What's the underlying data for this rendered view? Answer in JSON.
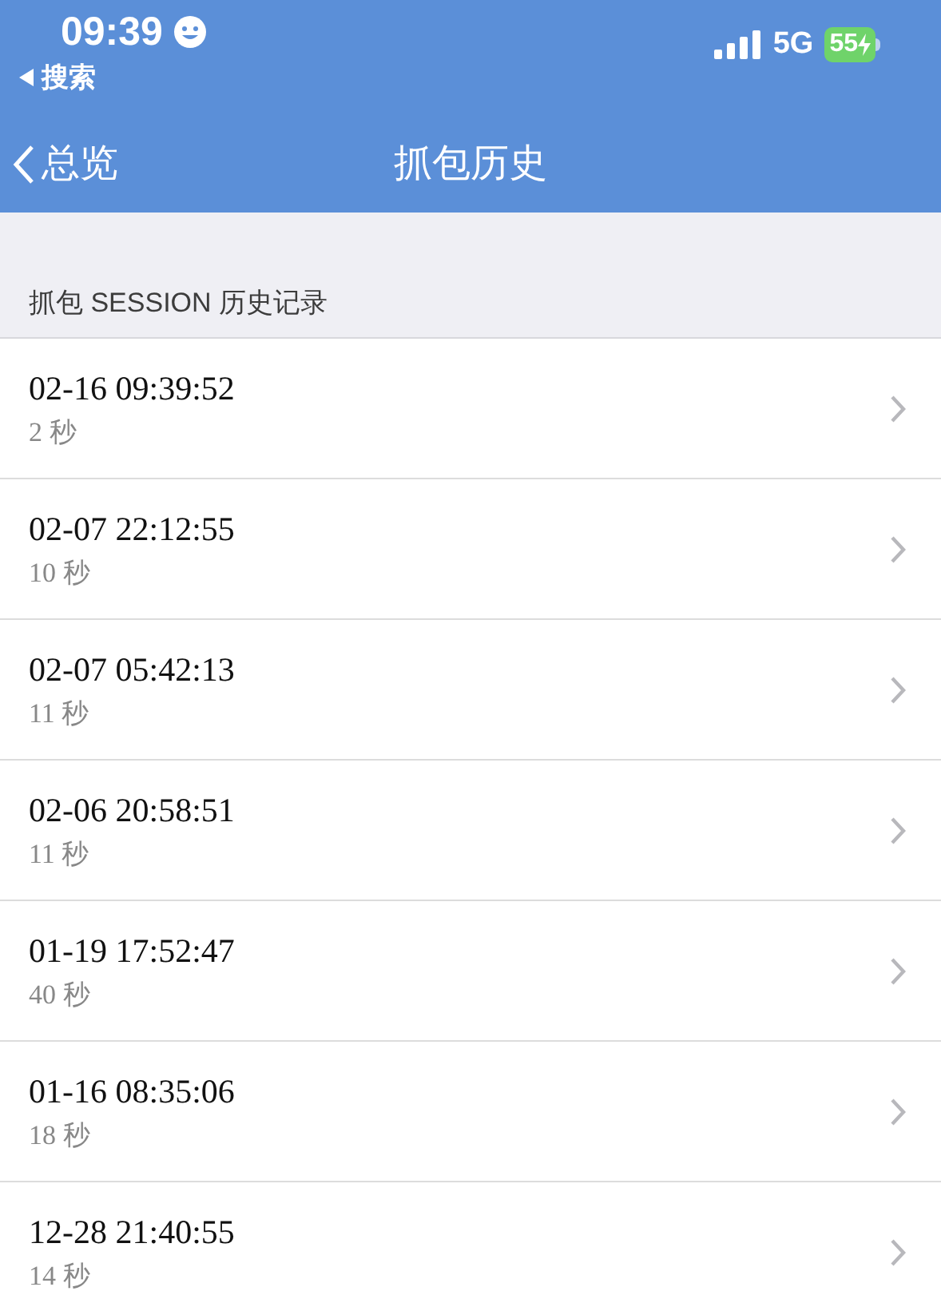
{
  "status_bar": {
    "time": "09:39",
    "back_app": "搜索",
    "network": "5G",
    "battery": "55"
  },
  "nav_bar": {
    "back": "总览",
    "title": "抓包历史"
  },
  "section_header": "抓包 SESSION 历史记录",
  "sessions": [
    {
      "time": "02-16 09:39:52",
      "duration": "2 秒"
    },
    {
      "time": "02-07 22:12:55",
      "duration": "10 秒"
    },
    {
      "time": "02-07 05:42:13",
      "duration": "11 秒"
    },
    {
      "time": "02-06 20:58:51",
      "duration": "11 秒"
    },
    {
      "time": "01-19 17:52:47",
      "duration": "40 秒"
    },
    {
      "time": "01-16 08:35:06",
      "duration": "18 秒"
    },
    {
      "time": "12-28 21:40:55",
      "duration": "14 秒"
    }
  ]
}
